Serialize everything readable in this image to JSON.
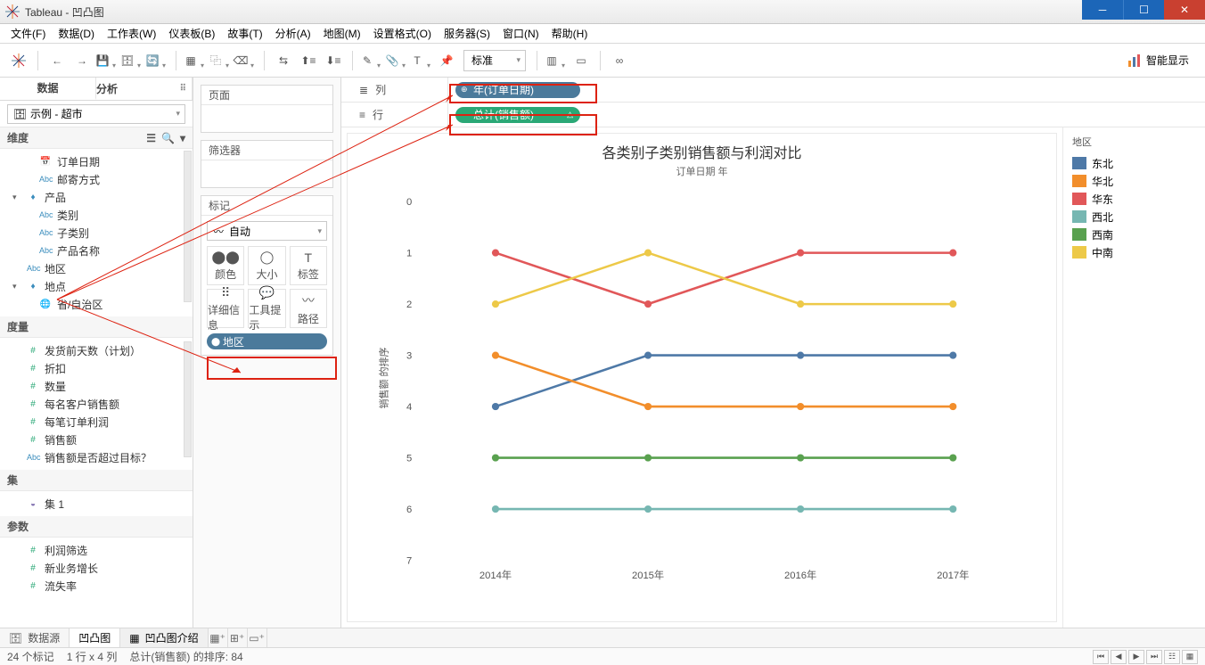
{
  "window": {
    "title": "Tableau - 凹凸图"
  },
  "menu": [
    "文件(F)",
    "数据(D)",
    "工作表(W)",
    "仪表板(B)",
    "故事(T)",
    "分析(A)",
    "地图(M)",
    "设置格式(O)",
    "服务器(S)",
    "窗口(N)",
    "帮助(H)"
  ],
  "toolbar": {
    "fit_combo": "标准",
    "show_me": "智能显示"
  },
  "left": {
    "tabs": [
      "数据",
      "分析"
    ],
    "datasource": "示例 - 超市",
    "dims_head": "维度",
    "dims": [
      {
        "icon": "date",
        "label": "订单日期",
        "indent": 1
      },
      {
        "icon": "abc",
        "label": "邮寄方式",
        "indent": 1
      },
      {
        "icon": "hier",
        "label": "产品",
        "indent": 0,
        "caret": "▾"
      },
      {
        "icon": "abc",
        "label": "类别",
        "indent": 1
      },
      {
        "icon": "abc",
        "label": "子类别",
        "indent": 1
      },
      {
        "icon": "abc",
        "label": "产品名称",
        "indent": 1
      },
      {
        "icon": "abc",
        "label": "地区",
        "indent": 0
      },
      {
        "icon": "hier",
        "label": "地点",
        "indent": 0,
        "caret": "▾"
      },
      {
        "icon": "globe",
        "label": "省/自治区",
        "indent": 1
      }
    ],
    "meas_head": "度量",
    "meas": [
      {
        "icon": "num",
        "label": "发货前天数（计划）"
      },
      {
        "icon": "num",
        "label": "折扣"
      },
      {
        "icon": "num",
        "label": "数量"
      },
      {
        "icon": "num",
        "label": "每名客户销售额"
      },
      {
        "icon": "num",
        "label": "每笔订单利润"
      },
      {
        "icon": "num",
        "label": "销售额"
      },
      {
        "icon": "abc",
        "label": "销售额是否超过目标？"
      }
    ],
    "sets_head": "集",
    "sets": [
      {
        "icon": "set",
        "label": "集 1"
      }
    ],
    "params_head": "参数",
    "params": [
      {
        "icon": "num",
        "label": "利润筛选"
      },
      {
        "icon": "num",
        "label": "新业务增长"
      },
      {
        "icon": "num",
        "label": "流失率"
      }
    ]
  },
  "mid": {
    "pages": "页面",
    "filters": "筛选器",
    "marks_head": "标记",
    "marks_type": "自动",
    "mark_cells": [
      "颜色",
      "大小",
      "标签",
      "详细信息",
      "工具提示",
      "路径"
    ],
    "mark_pill": "地区"
  },
  "shelves": {
    "col_label": "列",
    "col_pill": "年(订单日期)",
    "row_label": "行",
    "row_pill": "总计(销售额)"
  },
  "viz": {
    "title": "各类别子类别销售额与利润对比",
    "subtitle": "订单日期 年",
    "ylabel": "销售额 的排序"
  },
  "legend": {
    "head": "地区",
    "items": [
      {
        "label": "东北",
        "color": "#4e79a7"
      },
      {
        "label": "华北",
        "color": "#f28e2b"
      },
      {
        "label": "华东",
        "color": "#e15759"
      },
      {
        "label": "西北",
        "color": "#76b7b2"
      },
      {
        "label": "西南",
        "color": "#59a14f"
      },
      {
        "label": "中南",
        "color": "#edc948"
      }
    ]
  },
  "chart_data": {
    "type": "line",
    "title": "各类别子类别销售额与利润对比",
    "xlabel": "订单日期 年",
    "ylabel": "销售额 的排序",
    "ylim": [
      7,
      0
    ],
    "categories": [
      "2014年",
      "2015年",
      "2016年",
      "2017年"
    ],
    "series": [
      {
        "name": "东北",
        "color": "#4e79a7",
        "values": [
          4,
          3,
          3,
          3
        ]
      },
      {
        "name": "华北",
        "color": "#f28e2b",
        "values": [
          3,
          4,
          4,
          4
        ]
      },
      {
        "name": "华东",
        "color": "#e15759",
        "values": [
          1,
          2,
          1,
          1
        ]
      },
      {
        "name": "西北",
        "color": "#76b7b2",
        "values": [
          6,
          6,
          6,
          6
        ]
      },
      {
        "name": "西南",
        "color": "#59a14f",
        "values": [
          5,
          5,
          5,
          5
        ]
      },
      {
        "name": "中南",
        "color": "#edc948",
        "values": [
          2,
          1,
          2,
          2
        ]
      }
    ]
  },
  "sheets": {
    "source": "数据源",
    "tabs": [
      "凹凸图",
      "凹凸图介绍"
    ]
  },
  "status": {
    "marks": "24 个标记",
    "rc": "1 行 x 4 列",
    "agg": "总计(销售额) 的排序: 84"
  }
}
